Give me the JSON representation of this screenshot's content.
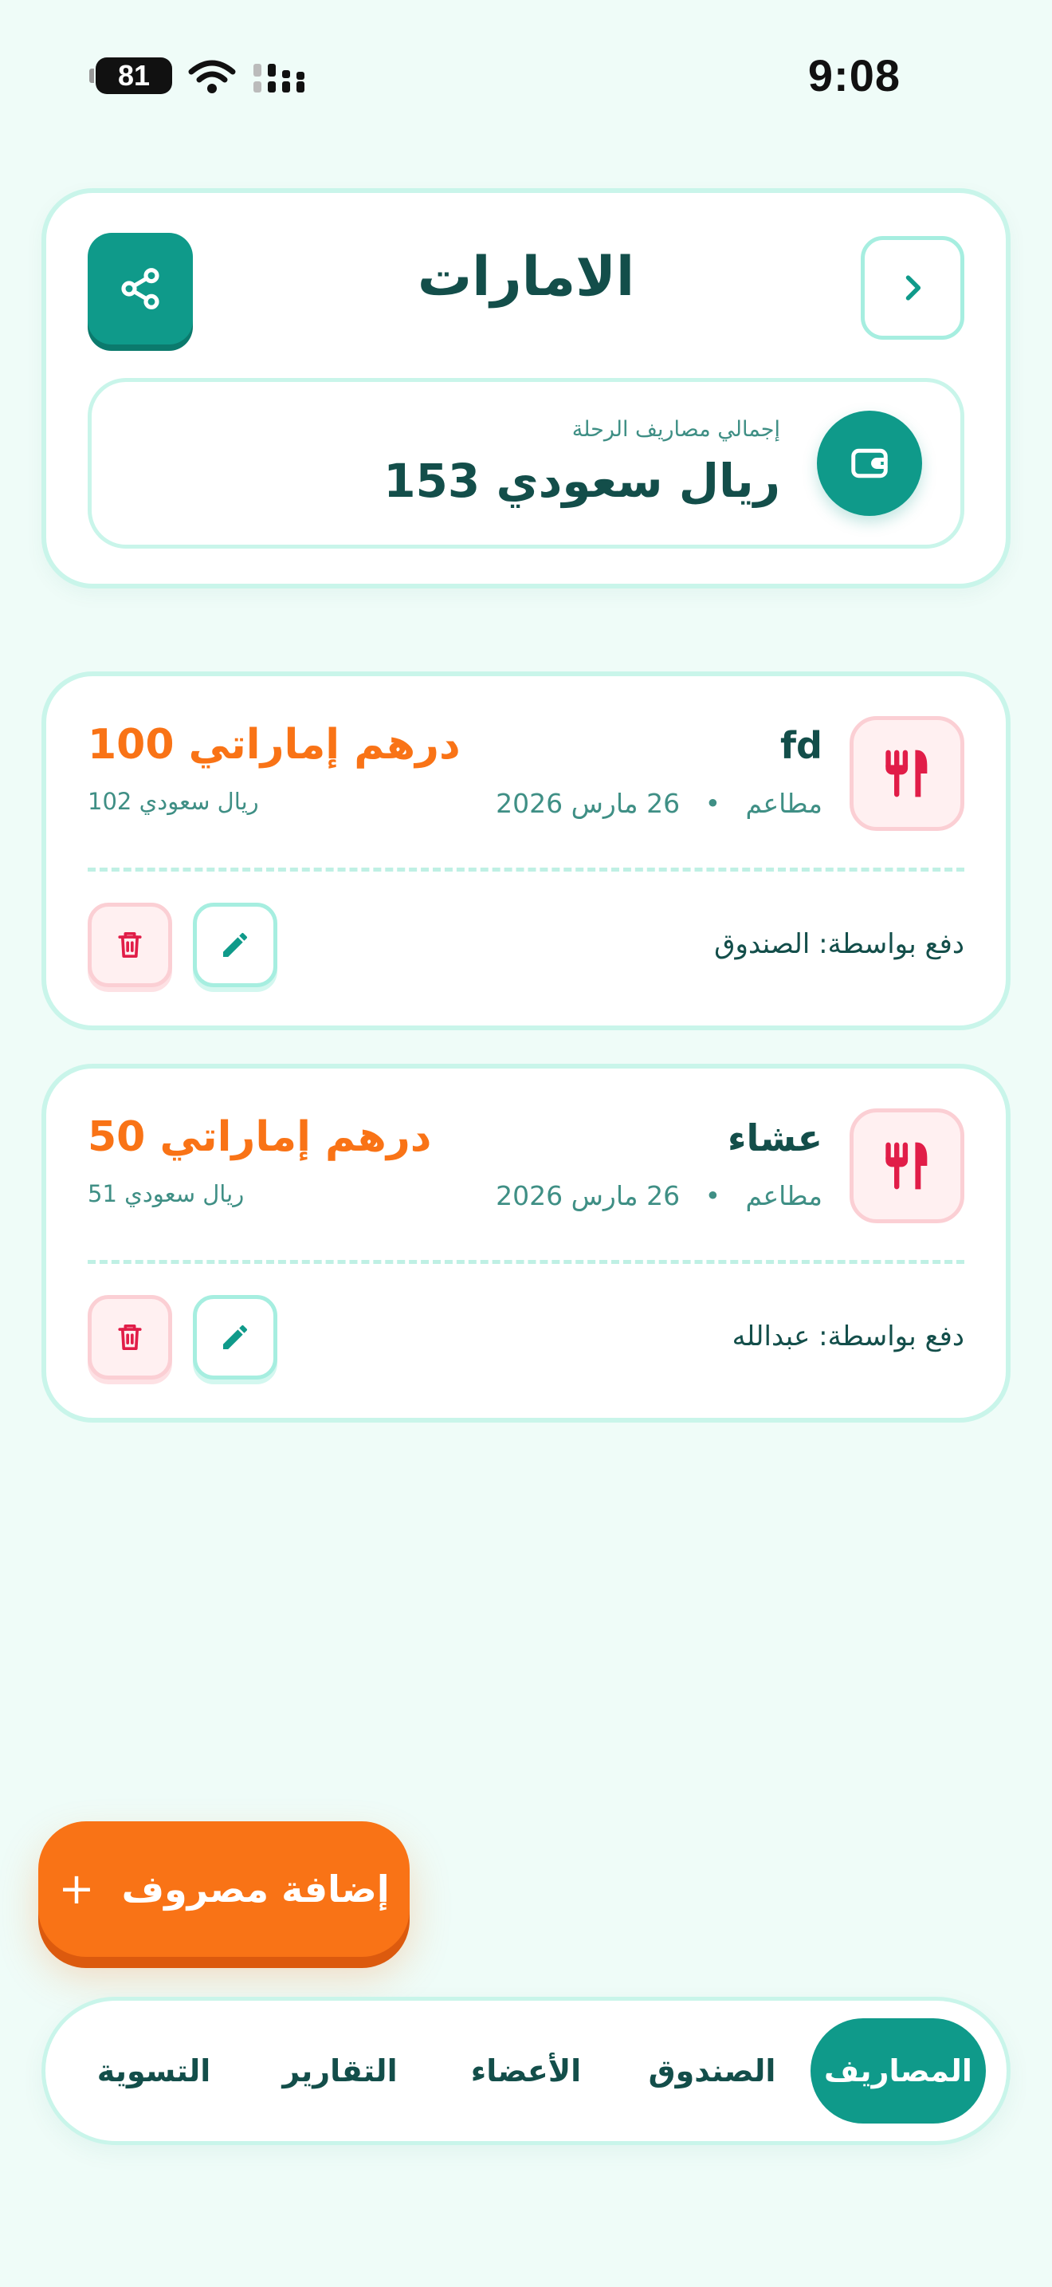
{
  "status_bar": {
    "time": "9:08",
    "battery": "81"
  },
  "header": {
    "title": "الامارات",
    "total_label": "إجمالي مصاريف الرحلة",
    "total_value": "153 ريال سعودي"
  },
  "expenses": [
    {
      "name": "fd",
      "category": "مطاعم",
      "date": "26 مارس 2026",
      "amount": "100 درهم إماراتي",
      "converted": "102 ريال سعودي",
      "paid_by": "دفع بواسطة: الصندوق"
    },
    {
      "name": "عشاء",
      "category": "مطاعم",
      "date": "26 مارس 2026",
      "amount": "50 درهم إماراتي",
      "converted": "51 ريال سعودي",
      "paid_by": "دفع بواسطة: عبدالله"
    }
  ],
  "fab": {
    "label": "إضافة مصروف",
    "icon": "plus-icon"
  },
  "nav": {
    "items": [
      {
        "label": "المصاريف",
        "active": true
      },
      {
        "label": "الصندوق",
        "active": false
      },
      {
        "label": "الأعضاء",
        "active": false
      },
      {
        "label": "التقارير",
        "active": false
      },
      {
        "label": "التسوية",
        "active": false
      }
    ]
  },
  "colors": {
    "background": "#effcf8",
    "primary": "#0f9a8a",
    "accent": "#f97316",
    "danger": "#e11d48",
    "text": "#134e4a"
  },
  "icons": {
    "share": "share-icon",
    "back": "chevron-right-icon",
    "wallet": "wallet-icon",
    "category": "utensils-icon",
    "delete": "trash-icon",
    "edit": "pencil-icon"
  }
}
